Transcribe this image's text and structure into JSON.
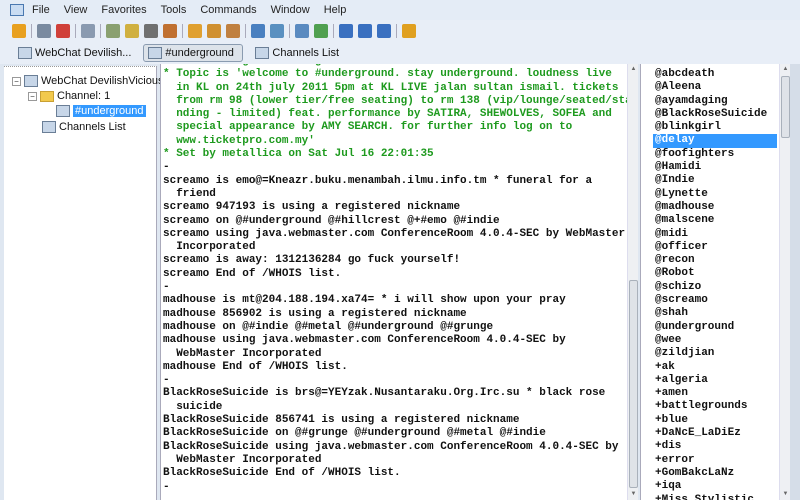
{
  "menu": [
    "File",
    "View",
    "Favorites",
    "Tools",
    "Commands",
    "Window",
    "Help"
  ],
  "toolbar_icons": [
    "connect-icon",
    "server-icon",
    "favorites-icon",
    "options-icon",
    "log-icon",
    "address-book-icon",
    "timer-icon",
    "scripts-icon",
    "join-icon",
    "nick-icon",
    "away-icon",
    "find-icon",
    "search-icon",
    "channel-list-icon",
    "notify-icon",
    "tile-horizontal-icon",
    "tile-vertical-icon",
    "cascade-icon",
    "help-icon"
  ],
  "tabs": [
    {
      "label": "WebChat Devilish..."
    },
    {
      "label": "#underground"
    },
    {
      "label": "Channels List"
    }
  ],
  "tree": {
    "server": "WebChat DevilishVicious",
    "channel_group": "Channel: 1",
    "channel": "#underground",
    "channels_list": "Channels List"
  },
  "chat": [
    {
      "text": "* Now talking in #underground",
      "color": "green"
    },
    {
      "text": "* Topic is 'welcome to #underground. stay underground. loudness live\n  in KL on 24th july 2011 5pm at KL LIVE jalan sultan ismail. tickets\n  from rm 98 (lower tier/free seating) to rm 138 (vip/lounge/seated/sta\n  nding - limited) feat. performance by SATIRA, SHEWOLVES, SOFEA and\n  special appearance by AMY SEARCH. for further info log on to\n  www.ticketpro.com.my'",
      "color": "green"
    },
    {
      "text": "* Set by metallica on Sat Jul 16 22:01:35",
      "color": "green"
    },
    {
      "text": "-",
      "color": "black"
    },
    {
      "text": "screamo is emo@=Kneazr.buku.menambah.ilmu.info.tm * funeral for a\n  friend",
      "color": "black"
    },
    {
      "text": "screamo 947193 is using a registered nickname",
      "color": "black"
    },
    {
      "text": "screamo on @#underground @#hillcrest @+#emo @#indie",
      "color": "black"
    },
    {
      "text": "screamo using java.webmaster.com ConferenceRoom 4.0.4-SEC by WebMaster\n  Incorporated",
      "color": "black"
    },
    {
      "text": "screamo is away: 1312136284 go fuck yourself!",
      "color": "black"
    },
    {
      "text": "screamo End of /WHOIS list.",
      "color": "black"
    },
    {
      "text": "-",
      "color": "black"
    },
    {
      "text": "madhouse is mt@204.188.194.xa74= * i will show upon your pray",
      "color": "black"
    },
    {
      "text": "madhouse 856902 is using a registered nickname",
      "color": "black"
    },
    {
      "text": "madhouse on @#indie @#metal @#underground @#grunge",
      "color": "black"
    },
    {
      "text": "madhouse using java.webmaster.com ConferenceRoom 4.0.4-SEC by\n  WebMaster Incorporated",
      "color": "black"
    },
    {
      "text": "madhouse End of /WHOIS list.",
      "color": "black"
    },
    {
      "text": "-",
      "color": "black"
    },
    {
      "text": "BlackRoseSuicide is brs@=YEYzak.Nusantaraku.Org.Irc.su * black rose\n  suicide",
      "color": "black"
    },
    {
      "text": "BlackRoseSuicide 856741 is using a registered nickname",
      "color": "black"
    },
    {
      "text": "BlackRoseSuicide on @#grunge @#underground @#metal @#indie",
      "color": "black"
    },
    {
      "text": "BlackRoseSuicide using java.webmaster.com ConferenceRoom 4.0.4-SEC by\n  WebMaster Incorporated",
      "color": "black"
    },
    {
      "text": "BlackRoseSuicide End of /WHOIS list.",
      "color": "black"
    },
    {
      "text": "-",
      "color": "black"
    }
  ],
  "nicks": [
    "@abcdeath",
    "@Aleena",
    "@ayamdaging",
    "@BlackRoseSuicide",
    "@blinkgirl",
    "@delay",
    "@foofighters",
    "@Hamidi",
    "@Indie",
    "@Lynette",
    "@madhouse",
    "@malscene",
    "@midi",
    "@officer",
    "@recon",
    "@Robot",
    "@schizo",
    "@screamo",
    "@shah",
    "@underground",
    "@wee",
    "@zildjian",
    "+ak",
    "+algeria",
    "+amen",
    "+battlegrounds",
    "+blue",
    "+DaNcE_LaDiEz",
    "+dis",
    "+error",
    "+GomBakcLaNz",
    "+iqa",
    "+Miss_Stylistic"
  ],
  "selected_nick": "@delay",
  "colors": {
    "green": "#1e9a1e",
    "selection": "#3399ff"
  }
}
